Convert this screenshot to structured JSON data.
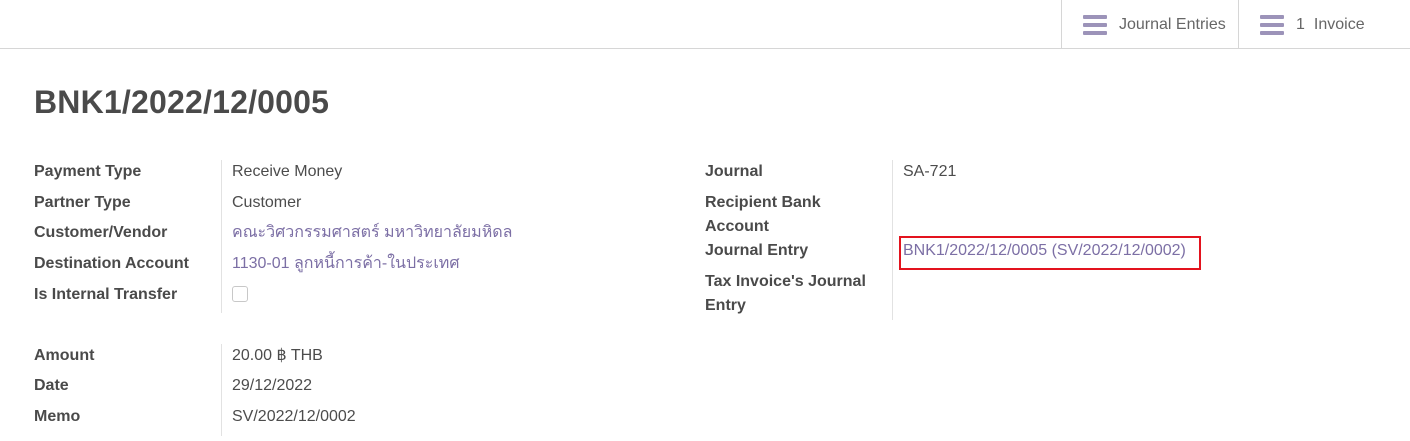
{
  "smart_buttons": {
    "journal_entries_label": "Journal Entries",
    "invoice_count": "1",
    "invoice_label": "Invoice"
  },
  "record": {
    "title": "BNK1/2022/12/0005"
  },
  "left_group": {
    "payment_type_label": "Payment Type",
    "payment_type_value": "Receive Money",
    "partner_type_label": "Partner Type",
    "partner_type_value": "Customer",
    "customer_vendor_label": "Customer/Vendor",
    "customer_vendor_value": "คณะวิศวกรรมศาสตร์ มหาวิทยาลัยมหิดล",
    "destination_account_label": "Destination Account",
    "destination_account_value": "1130-01 ลูกหนี้การค้า-ในประเทศ",
    "internal_transfer_label": "Is Internal Transfer",
    "internal_transfer_checked": false
  },
  "right_group": {
    "journal_label": "Journal",
    "journal_value": "SA-721",
    "recipient_bank_label_line1": "Recipient Bank",
    "recipient_bank_label_line2": "Account",
    "journal_entry_label": "Journal Entry",
    "journal_entry_value": "BNK1/2022/12/0005 (SV/2022/12/0002)",
    "tax_invoice_label_line1": "Tax Invoice's Journal",
    "tax_invoice_label_line2": "Entry"
  },
  "bottom_group": {
    "amount_label": "Amount",
    "amount_value": "20.00 ฿ THB",
    "date_label": "Date",
    "date_value": "29/12/2022",
    "memo_label": "Memo",
    "memo_value": "SV/2022/12/0002"
  },
  "colors": {
    "link": "#7c6fa5",
    "icon": "#9c93b9",
    "highlight": "#e3131e"
  }
}
